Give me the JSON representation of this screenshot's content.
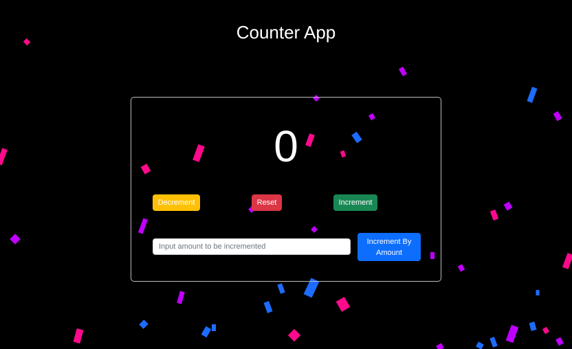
{
  "app": {
    "title": "Counter App",
    "count": "0"
  },
  "buttons": {
    "decrement_label": "Decrement",
    "reset_label": "Reset",
    "increment_label": "Increment",
    "increment_by_amount_label": "Increment By Amount"
  },
  "amount_input": {
    "placeholder": "Input amount to be incremented",
    "value": ""
  },
  "colors": {
    "background": "#000000",
    "decrement": "#ffc107",
    "reset": "#dc3545",
    "increment": "#198754",
    "increment_by_amount": "#0d6efd",
    "confetti_pink": "#ff0a8c",
    "confetti_purple": "#c000ff",
    "confetti_blue": "#1e6cff"
  }
}
